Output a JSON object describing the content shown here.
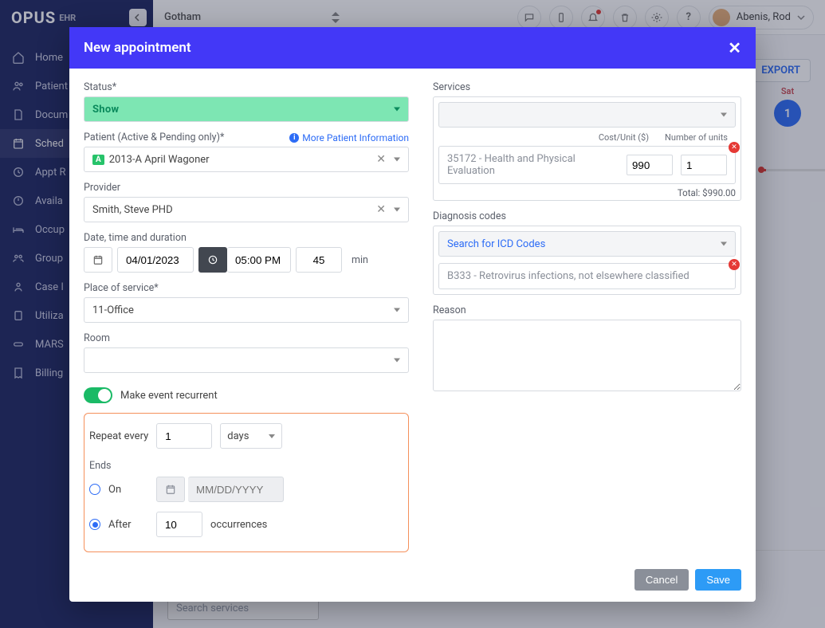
{
  "app": {
    "logo": "OPUS",
    "logo_sub": "EHR",
    "location": "Gotham",
    "export": "EXPORT",
    "user": "Abenis, Rod",
    "day_label": "Sat",
    "day_num": "1",
    "search_services_ph": "Search services"
  },
  "sidebar": {
    "items": [
      {
        "label": "Home"
      },
      {
        "label": "Patient"
      },
      {
        "label": "Docum"
      },
      {
        "label": "Sched"
      },
      {
        "label": "Appt R"
      },
      {
        "label": "Availa"
      },
      {
        "label": "Occup"
      },
      {
        "label": "Group"
      },
      {
        "label": "Case I"
      },
      {
        "label": "Utiliza"
      },
      {
        "label": "MARS"
      },
      {
        "label": "Billing"
      }
    ]
  },
  "modal": {
    "title": "New appointment",
    "status_label": "Status*",
    "status_value": "Show",
    "patient_label": "Patient (Active & Pending only)*",
    "patient_link": "More Patient Information",
    "patient_badge": "A",
    "patient_value": "2013-A   April Wagoner",
    "provider_label": "Provider",
    "provider_value": "Smith, Steve PHD",
    "dtd_label": "Date, time and duration",
    "date": "04/01/2023",
    "time": "05:00 PM",
    "duration": "45",
    "duration_unit": "min",
    "pos_label": "Place of service*",
    "pos_value": "11-Office",
    "room_label": "Room",
    "room_value": "",
    "recurrent_label": "Make event recurrent",
    "recurrence": {
      "repeat_label": "Repeat every",
      "repeat_n": "1",
      "repeat_unit": "days",
      "ends_label": "Ends",
      "on_label": "On",
      "on_placeholder": "MM/DD/YYYY",
      "after_label": "After",
      "after_n": "10",
      "after_unit": "occurrences"
    },
    "services_label": "Services",
    "cost_label": "Cost/Unit ($)",
    "units_label": "Number of units",
    "svc_item_name": "35172 - Health and Physical Evaluation",
    "svc_item_cost": "990",
    "svc_item_units": "1",
    "total_label": "Total: $990.00",
    "diag_label": "Diagnosis codes",
    "diag_search_ph": "Search for ICD Codes",
    "diag_item": "B333 - Retrovirus infections, not elsewhere classified",
    "reason_label": "Reason",
    "cancel": "Cancel",
    "save": "Save"
  }
}
